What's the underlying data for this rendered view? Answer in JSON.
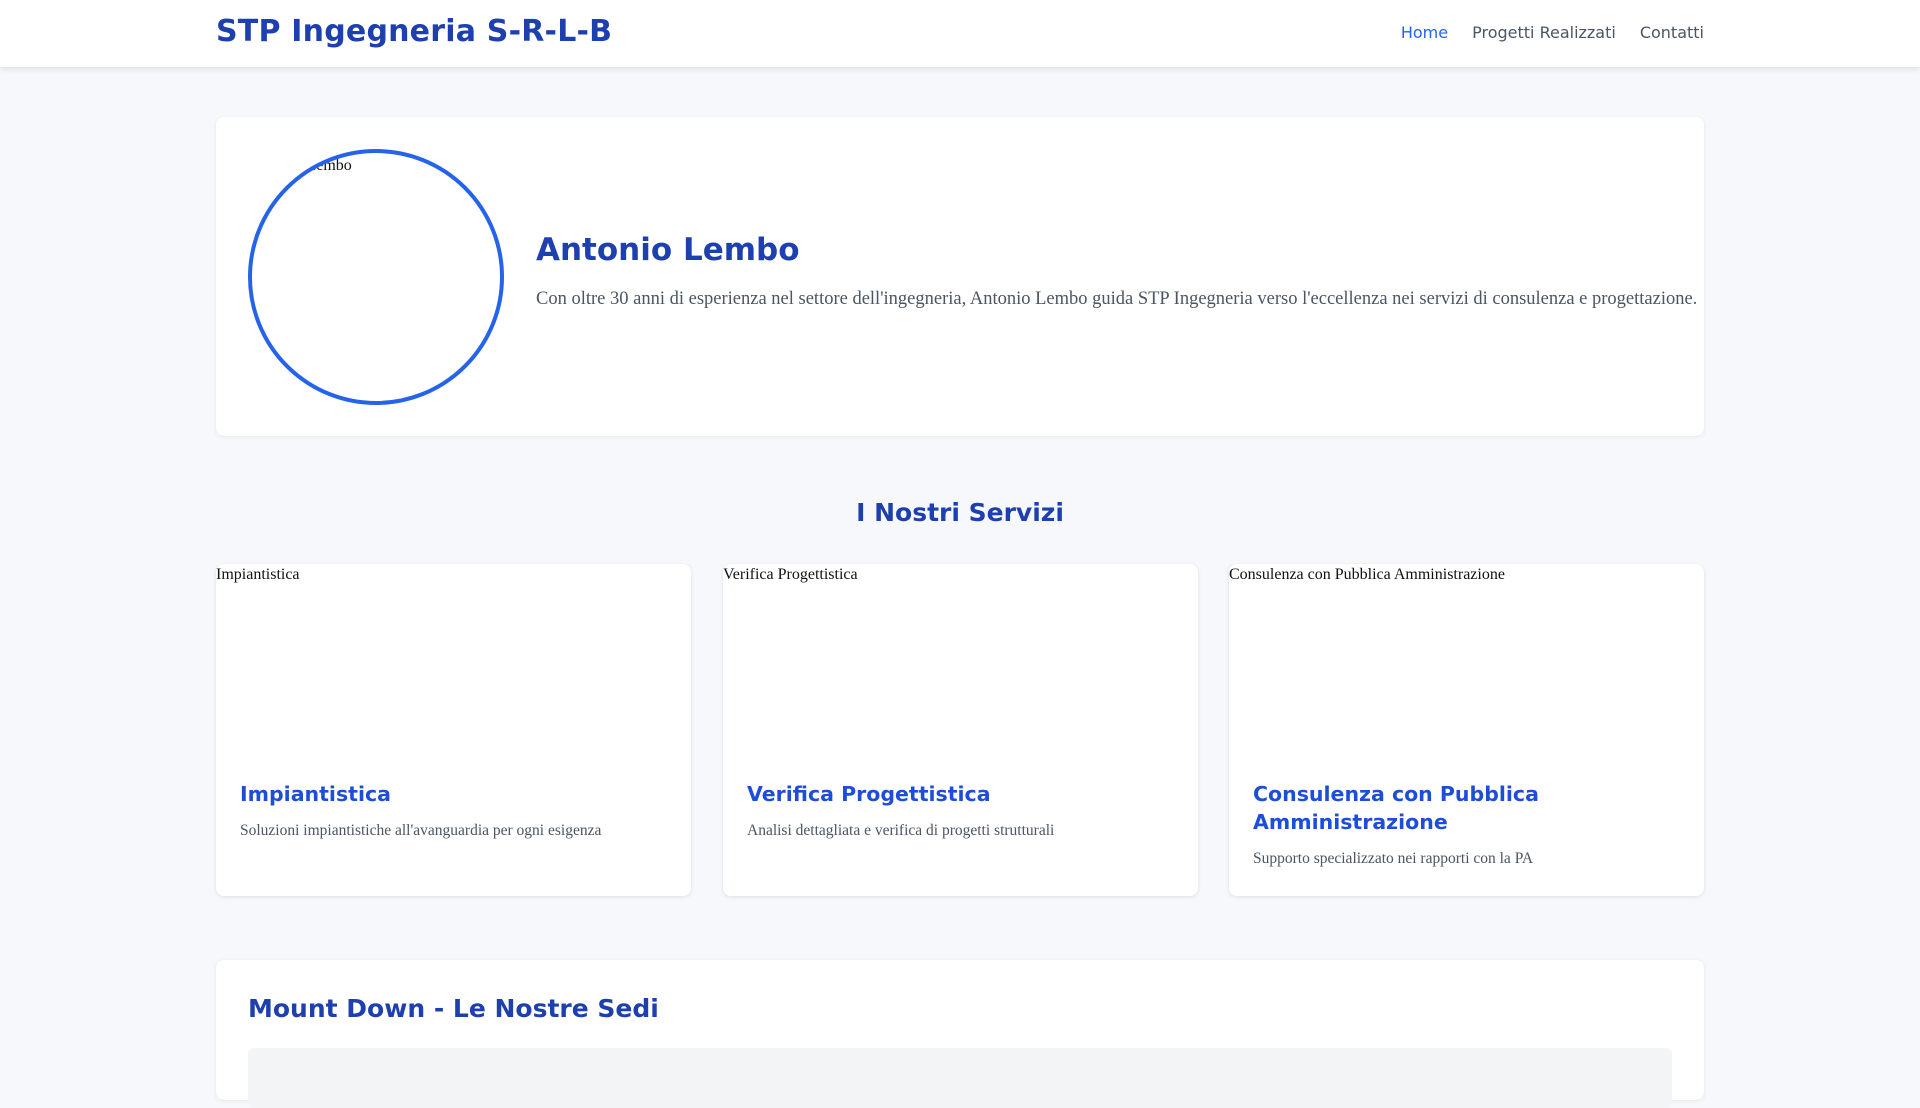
{
  "header": {
    "brand": "STP Ingegneria S-R-L-B",
    "nav": [
      {
        "label": "Home",
        "active": true
      },
      {
        "label": "Progetti Realizzati",
        "active": false
      },
      {
        "label": "Contatti",
        "active": false
      }
    ]
  },
  "profile": {
    "image_alt": "Antonio Lembo",
    "name": "Antonio Lembo",
    "bio": "Con oltre 30 anni di esperienza nel settore dell'ingegneria, Antonio Lembo guida STP Ingegneria verso l'eccellenza nei servizi di consulenza e progettazione."
  },
  "services": {
    "title": "I Nostri Servizi",
    "items": [
      {
        "image_alt": "Impiantistica",
        "title": "Impiantistica",
        "description": "Soluzioni impiantistiche all'avanguardia per ogni esigenza"
      },
      {
        "image_alt": "Verifica Progettistica",
        "title": "Verifica Progettistica",
        "description": "Analisi dettagliata e verifica di progetti strutturali"
      },
      {
        "image_alt": "Consulenza con Pubblica Amministrazione",
        "title": "Consulenza con Pubblica Amministrazione",
        "description": "Supporto specializzato nei rapporti con la PA"
      }
    ]
  },
  "locations": {
    "title": "Mount Down - Le Nostre Sedi"
  },
  "colors": {
    "brand": "#1e40af",
    "accent": "#2563eb",
    "page_background": "#f7f8fb"
  }
}
